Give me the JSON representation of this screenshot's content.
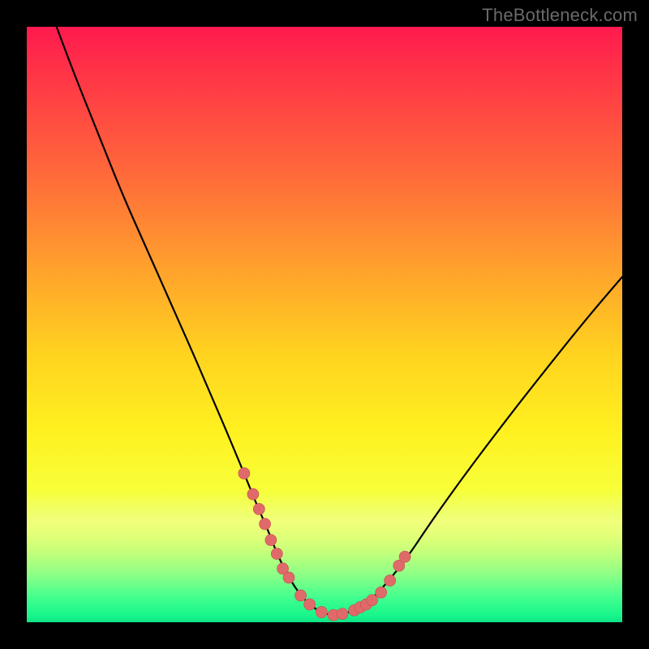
{
  "watermark": "TheBottleneck.com",
  "chart_data": {
    "type": "line",
    "title": "",
    "xlabel": "",
    "ylabel": "",
    "xlim": [
      0,
      100
    ],
    "ylim": [
      0,
      100
    ],
    "series": [
      {
        "name": "curve",
        "x": [
          5,
          8,
          12,
          16,
          20,
          24,
          28,
          31,
          34,
          36.5,
          38.5,
          40.5,
          42,
          44,
          46,
          48,
          50,
          52,
          54,
          57,
          60,
          64,
          68,
          73,
          79,
          86,
          94,
          100
        ],
        "y": [
          100,
          92,
          82,
          72,
          63,
          54,
          45,
          38,
          31,
          25,
          20,
          15.5,
          11.5,
          7.5,
          4.5,
          2.5,
          1.4,
          1.2,
          1.6,
          3.0,
          6.0,
          11,
          17,
          24,
          32,
          41,
          51,
          58
        ]
      },
      {
        "name": "dots",
        "x": [
          36.5,
          38.0,
          39.0,
          40.0,
          41.0,
          42.0,
          43.0,
          44.0,
          46.0,
          47.5,
          49.5,
          51.5,
          53.0,
          55.0,
          56.0,
          57.0,
          58.0,
          59.5,
          61.0,
          62.5,
          63.5
        ],
        "y": [
          25.0,
          21.5,
          19.0,
          16.5,
          13.8,
          11.5,
          9.0,
          7.5,
          4.5,
          3.0,
          1.7,
          1.2,
          1.4,
          2.0,
          2.5,
          3.0,
          3.7,
          5.0,
          7.0,
          9.5,
          11.0
        ]
      }
    ]
  }
}
